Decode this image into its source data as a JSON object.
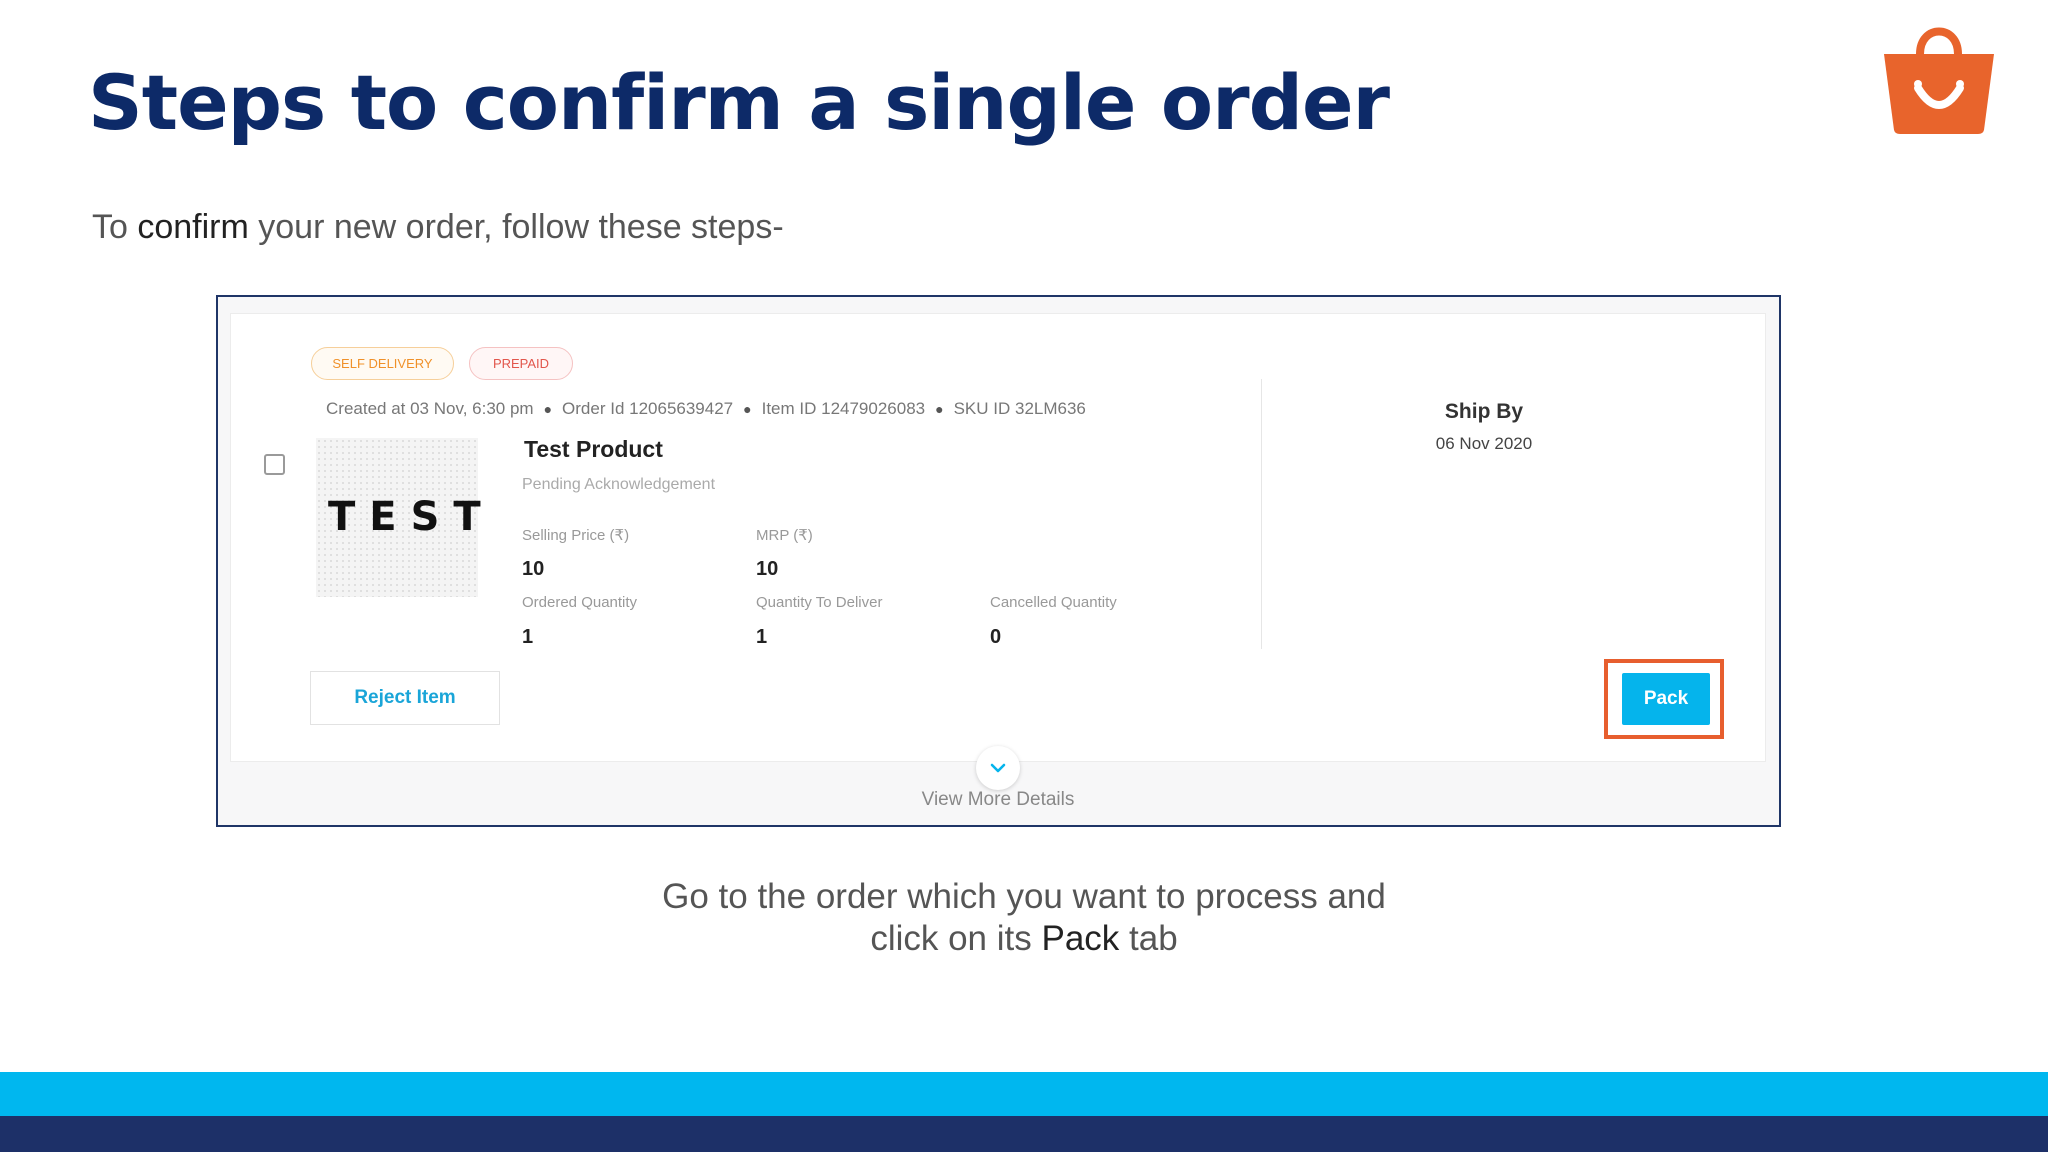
{
  "slide": {
    "title": "Steps to confirm a single order",
    "intro": {
      "before": "To ",
      "emphasis": "confirm",
      "after": " your new order, follow these steps-"
    },
    "caption": {
      "line1": "Go to the order which you want to process and",
      "line2_before": "click on its ",
      "line2_emphasis": "Pack",
      "line2_after": " tab"
    },
    "logo_icon": "shopping-bag-logo-icon"
  },
  "order": {
    "badges": [
      "SELF DELIVERY",
      "PREPAID"
    ],
    "meta": {
      "created": "Created at 03 Nov, 6:30 pm",
      "order_id": "Order Id 12065639427",
      "item_id": "Item ID 12479026083",
      "sku_id": "SKU ID 32LM636"
    },
    "thumbnail_text": "TEST",
    "product_title": "Test Product",
    "status": "Pending Acknowledgement",
    "fields": {
      "selling_price_label": "Selling Price (₹)",
      "selling_price": "10",
      "mrp_label": "MRP (₹)",
      "mrp": "10",
      "ordered_qty_label": "Ordered Quantity",
      "ordered_qty": "1",
      "qty_to_deliver_label": "Quantity To Deliver",
      "qty_to_deliver": "1",
      "cancelled_qty_label": "Cancelled Quantity",
      "cancelled_qty": "0"
    },
    "ship_by_label": "Ship By",
    "ship_by_date": "06 Nov 2020",
    "reject_label": "Reject Item",
    "pack_label": "Pack",
    "view_more_label": "View More Details"
  },
  "colors": {
    "title": "#0d2a68",
    "accent_blue": "#05b4ec",
    "highlight_orange": "#e75e2e",
    "band_light": "#00b7ef",
    "band_dark": "#1d3068"
  }
}
